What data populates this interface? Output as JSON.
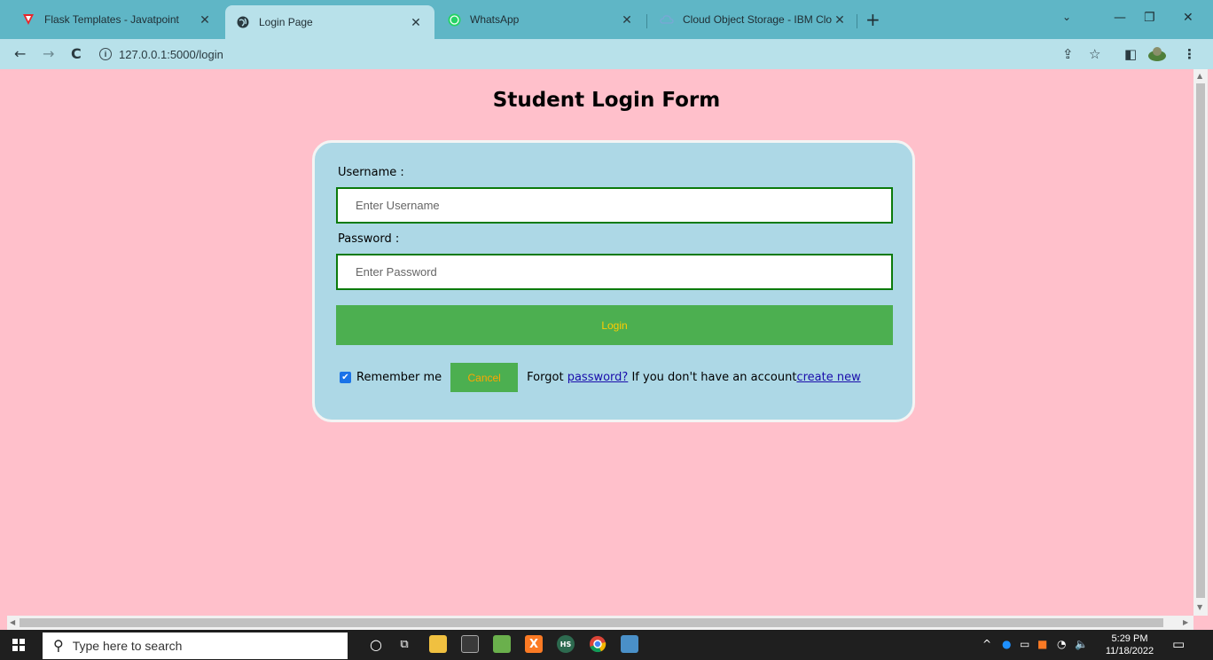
{
  "browser": {
    "tabs": [
      {
        "title": "Flask Templates - Javatpoint",
        "favicon": "javatpoint-icon",
        "active": false
      },
      {
        "title": "Login Page",
        "favicon": "globe-icon",
        "active": true
      },
      {
        "title": "WhatsApp",
        "favicon": "whatsapp-icon",
        "active": false
      },
      {
        "title": "Cloud Object Storage - IBM Clou",
        "favicon": "ibm-cloud-icon",
        "active": false
      }
    ],
    "new_tab_label": "+",
    "url": "127.0.0.1:5000/login"
  },
  "page": {
    "heading": "Student Login Form",
    "username_label": "Username :",
    "username_placeholder": "Enter Username",
    "password_label": "Password :",
    "password_placeholder": "Enter Password",
    "login_label": "Login",
    "remember_label": "Remember me",
    "remember_checked": true,
    "cancel_label": "Cancel",
    "forgot_prefix": "Forgot ",
    "forgot_link": "password?",
    "account_text": " If you don't have an account",
    "create_link": "create new"
  },
  "taskbar": {
    "search_placeholder": "Type here to search",
    "time": "5:29 PM",
    "date": "11/18/2022"
  },
  "colors": {
    "page_bg": "#ffc0cb",
    "card_bg": "#add8e6",
    "button_green": "#4caf50",
    "input_border": "#0b7a0b",
    "login_text": "#ffcc00",
    "cancel_text": "#ffa500",
    "tabbar": "#5fb6c6"
  }
}
